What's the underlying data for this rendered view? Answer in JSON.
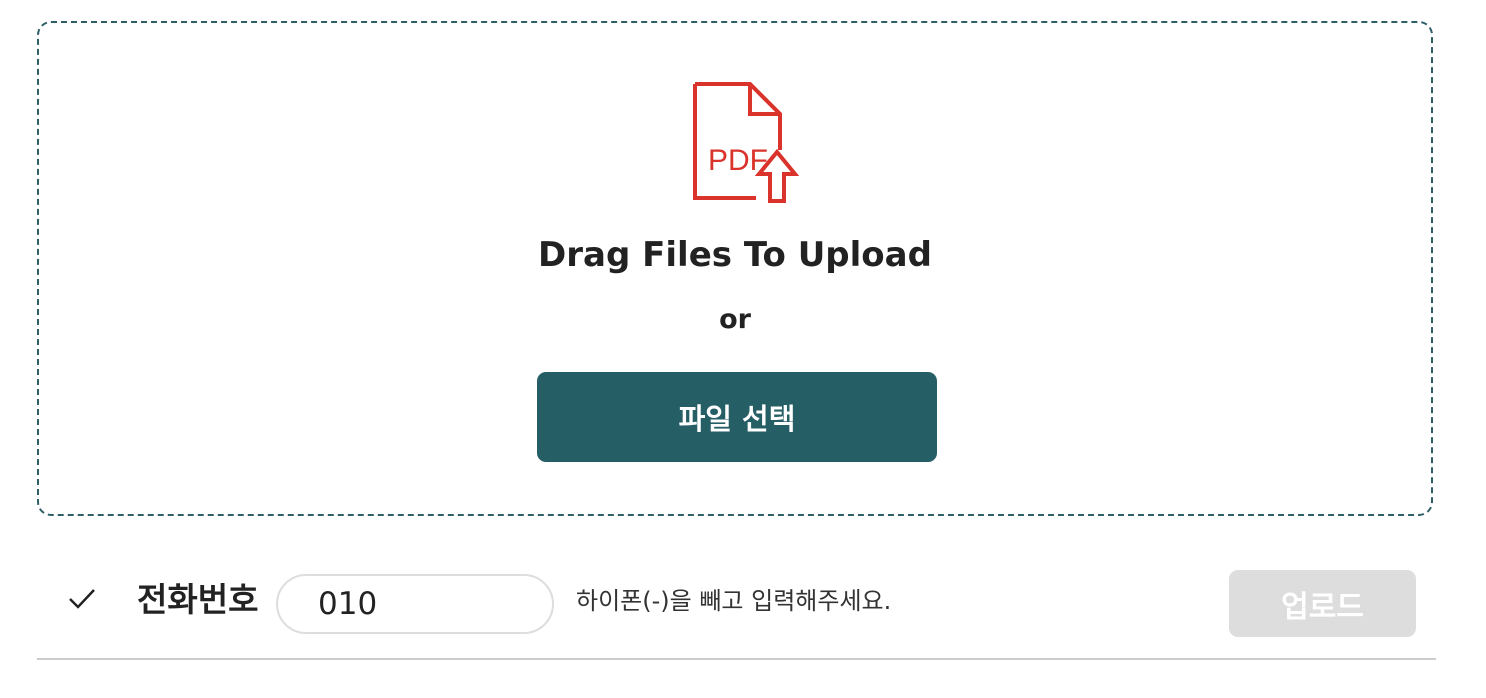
{
  "dropzone": {
    "icon": "pdf-upload-icon",
    "icon_text": "PDF",
    "title": "Drag Files To Upload",
    "or_text": "or",
    "select_button_label": "파일 선택"
  },
  "phone": {
    "check_icon": "checkmark-icon",
    "label": "전화번호",
    "input_value": "010",
    "hint": "하이폰(-)을 빼고 입력해주세요.",
    "upload_button_label": "업로드",
    "upload_button_state": "disabled"
  },
  "colors": {
    "accent": "#265e66",
    "icon": "#d9332b",
    "disabled": "#dddddd"
  }
}
